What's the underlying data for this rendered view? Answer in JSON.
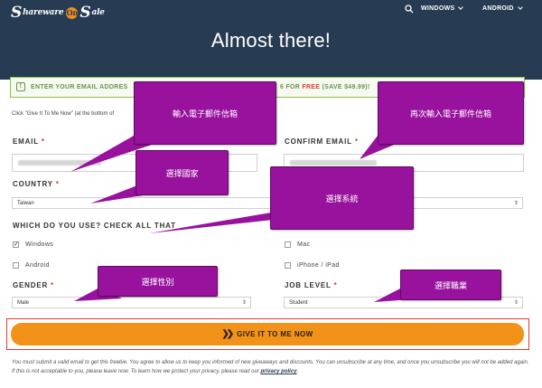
{
  "header": {
    "logo": {
      "part1": "S",
      "part2": "hareware",
      "badge": "On",
      "part3": "S",
      "part4": "ale"
    },
    "nav": {
      "windows": "WINDOWS",
      "android": "ANDROID"
    },
    "title": "Almost there!"
  },
  "notice": {
    "left": "ENTER YOUR EMAIL ADDRES",
    "right_pre": "6 FOR ",
    "right_free": "FREE",
    "right_post": " (SAVE $49.99)!"
  },
  "intro": "Click \"Give It To Me Now\" (at the bottom of",
  "form": {
    "email_label": "EMAIL",
    "confirm_email_label": "CONFIRM EMAIL",
    "country_label": "COUNTRY",
    "country_value": "Taiwan",
    "system_question": "WHICH DO YOU USE? CHECK ALL THAT",
    "options": {
      "windows": "Windows",
      "mac": "Mac",
      "android": "Android",
      "iphone": "iPhone / iPad"
    },
    "gender_label": "GENDER",
    "gender_value": "Male",
    "job_level_label": "JOB LEVEL",
    "job_level_value": "Student",
    "required_mark": "*"
  },
  "cta": {
    "label": "GIVE IT TO ME NOW"
  },
  "disclaimer": {
    "text": "You must submit a valid email to get this freebie. You agree to allow us to keep you informed of new giveaways and discounts. You can unsubscribe at any time, and once you unsubscribe you will not be added again. If this is not acceptable to you, please leave now. To learn how we protect your privacy, please read our ",
    "link": "privacy policy",
    "end": "."
  },
  "annotations": {
    "email": "輸入電子郵件信箱",
    "confirm_email": "再次輸入電子郵件信箱",
    "country": "選擇國家",
    "system": "選擇系統",
    "gender": "選擇性別",
    "job_level": "選擇職業"
  },
  "colors": {
    "header_bg": "#273c52",
    "accent_orange": "#f29219",
    "annotation_purple": "#99129e",
    "required_red": "#e23a2e"
  }
}
